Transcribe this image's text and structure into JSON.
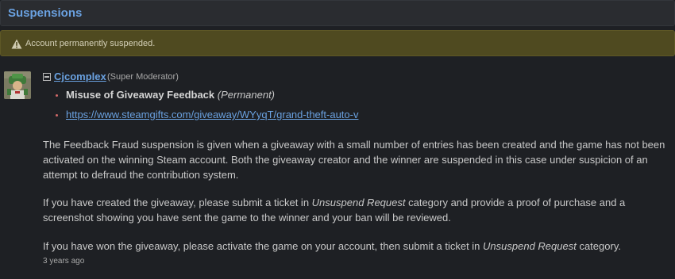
{
  "header": {
    "title": "Suspensions"
  },
  "alert": {
    "icon": "warning-icon",
    "text": "Account permanently suspended."
  },
  "comment": {
    "avatar_icon": "avatar-image",
    "author": {
      "name": "Cjcomplex",
      "role": "(Super Moderator)"
    },
    "reason": {
      "title": "Misuse of Giveaway Feedback",
      "duration": "(Permanent)"
    },
    "link": "https://www.steamgifts.com/giveaway/WYyqT/grand-theft-auto-v",
    "paragraph_1": "The Feedback Fraud suspension is given when a giveaway with a small number of entries has been created and the game has not been activated on the winning Steam account. Both the giveaway creator and the winner are suspended in this case under suspicion of an attempt to defraud the contribution system.",
    "paragraph_2": {
      "before": "If you have created the giveaway, please submit a ticket in ",
      "emphasis": "Unsuspend Request",
      "after": " category and provide a proof of purchase and a screenshot showing you have sent the game to the winner and your ban will be reviewed."
    },
    "paragraph_3": {
      "before": "If you have won the giveaway, please activate the game on your account, then submit a ticket in ",
      "emphasis": "Unsuspend Request",
      "after": " category."
    },
    "timestamp": "3 years ago"
  },
  "colors": {
    "background": "#1e2024",
    "accent_link": "#6aa1e0",
    "alert_bg": "#4f4a20",
    "bullet": "#d06868"
  }
}
